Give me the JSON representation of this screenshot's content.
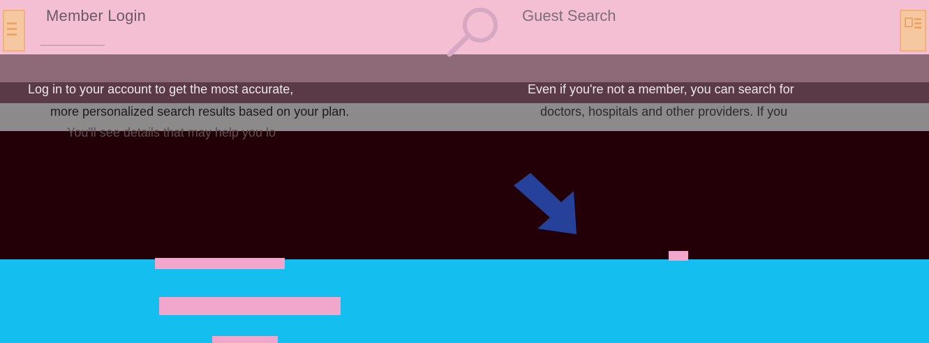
{
  "header": {
    "member_title": "Member Login",
    "guest_title": "Guest Search"
  },
  "member": {
    "description": [
      "Log in to your account to get the most accurate,",
      "more personalized search results based on your plan.",
      "You'll see details that may help you lo"
    ]
  },
  "guest": {
    "description": [
      "Even if you're not a member, you can search for",
      "doctors, hospitals and other providers. If you"
    ]
  },
  "colors": {
    "header_bg": "#f4bfd3",
    "accent_cyan": "#14bff0",
    "dark_band": "#230008",
    "arrow": "#26419a",
    "pink_button": "#f1a7cc"
  },
  "icons": {
    "left": "menu-icon",
    "right": "grid-icon",
    "center": "search-icon",
    "arrow": "arrow-down-right-icon"
  }
}
